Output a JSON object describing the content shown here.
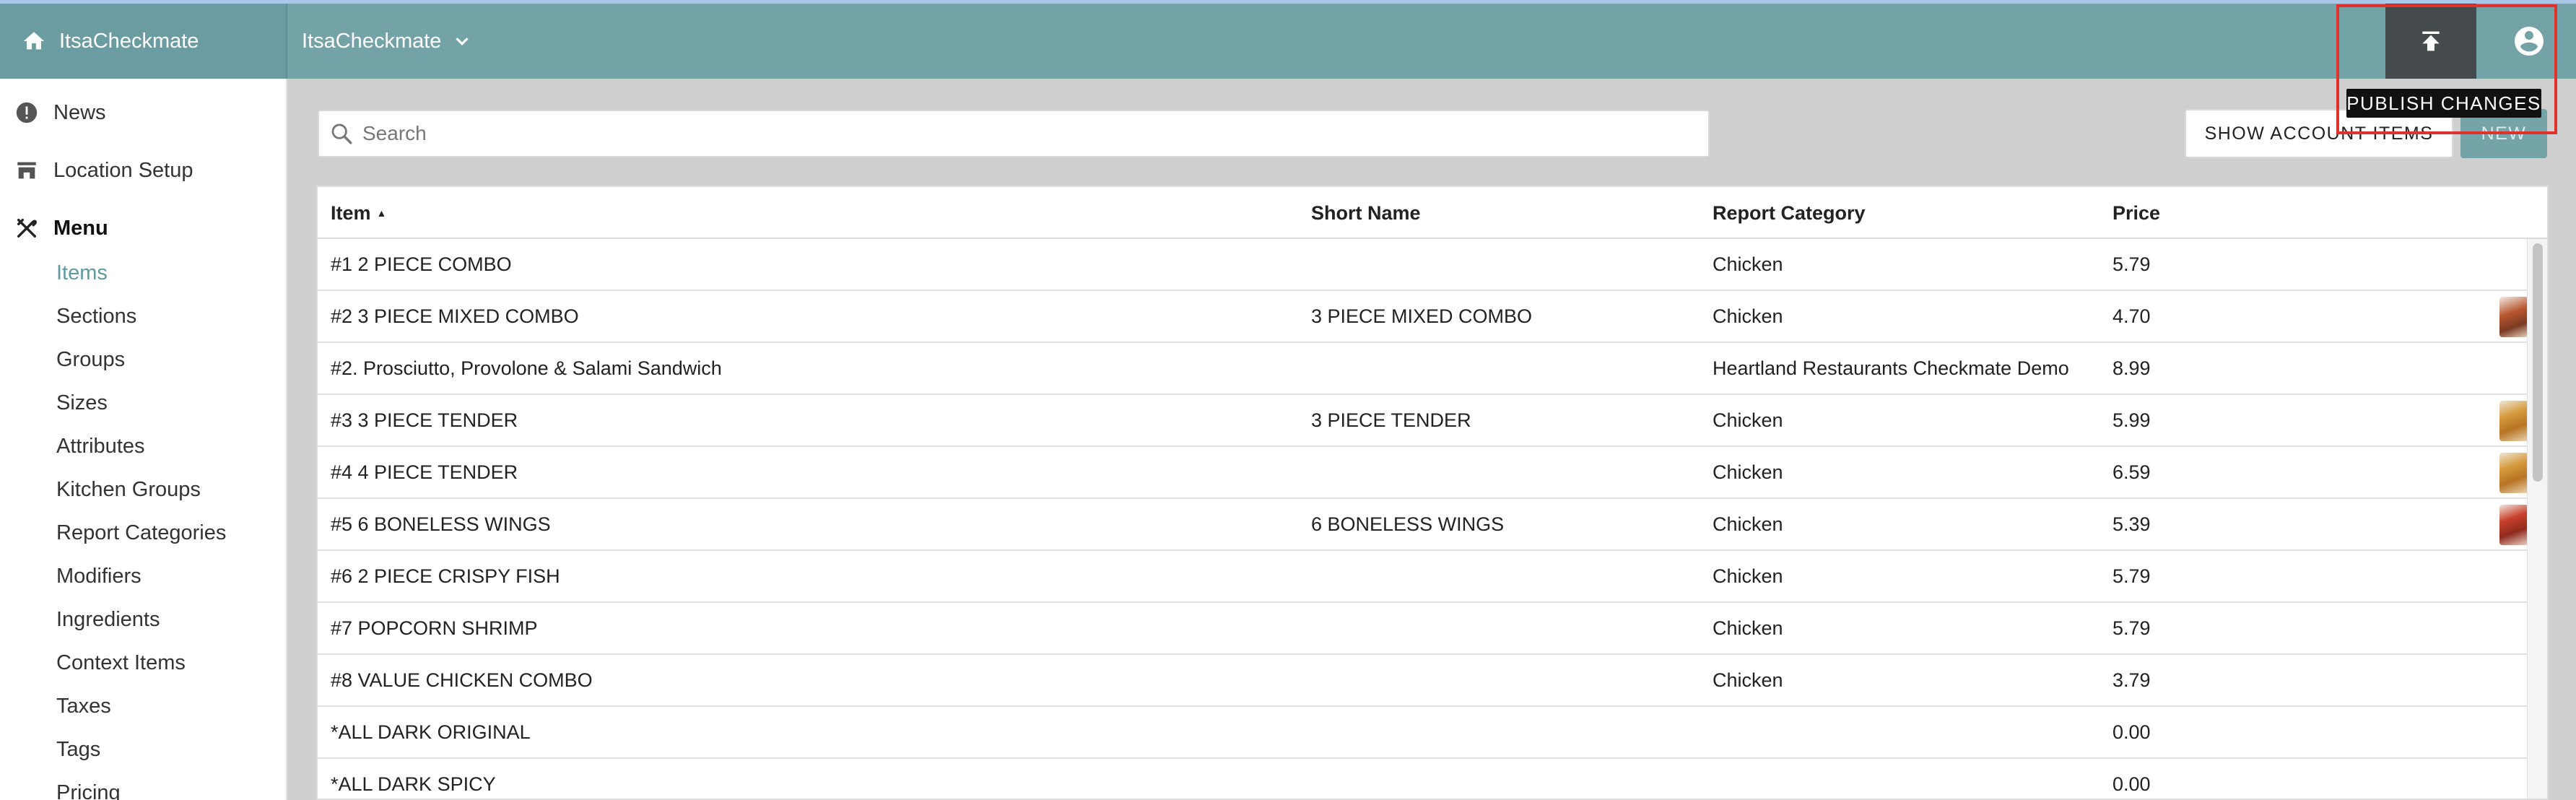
{
  "header": {
    "brand": "ItsaCheckmate",
    "location": "ItsaCheckmate",
    "publish_tooltip": "PUBLISH CHANGES"
  },
  "icons": {
    "home": "home-icon",
    "chevron": "chevron-down-icon",
    "publish": "publish-upload-icon",
    "account": "account-circle-icon",
    "news": "alert-circle-icon",
    "location": "store-icon",
    "menu": "fork-knife-icon",
    "search": "search-icon"
  },
  "sidebar": {
    "top": [
      {
        "label": "News"
      },
      {
        "label": "Location Setup"
      },
      {
        "label": "Menu"
      }
    ],
    "menu_items": [
      {
        "label": "Items",
        "active": true
      },
      {
        "label": "Sections"
      },
      {
        "label": "Groups"
      },
      {
        "label": "Sizes"
      },
      {
        "label": "Attributes"
      },
      {
        "label": "Kitchen Groups"
      },
      {
        "label": "Report Categories"
      },
      {
        "label": "Modifiers"
      },
      {
        "label": "Ingredients"
      },
      {
        "label": "Context Items"
      },
      {
        "label": "Taxes"
      },
      {
        "label": "Tags"
      },
      {
        "label": "Pricing"
      }
    ]
  },
  "toolbar": {
    "search_placeholder": "Search",
    "show_account_items": "SHOW ACCOUNT ITEMS",
    "new": "NEW"
  },
  "table": {
    "columns": [
      "Item",
      "Short Name",
      "Report Category",
      "Price"
    ],
    "sort_indicator": "▲",
    "rows": [
      {
        "item": "#1 2 PIECE COMBO",
        "short": "",
        "category": "Chicken",
        "price": "5.79"
      },
      {
        "item": "#2 3 PIECE MIXED COMBO",
        "short": "3 PIECE MIXED COMBO",
        "category": "Chicken",
        "price": "4.70"
      },
      {
        "item": "#2. Prosciutto, Provolone & Salami Sandwich",
        "short": "",
        "category": "Heartland Restaurants Checkmate Demo",
        "price": "8.99"
      },
      {
        "item": "#3 3 PIECE TENDER",
        "short": "3 PIECE TENDER",
        "category": "Chicken",
        "price": "5.99"
      },
      {
        "item": "#4 4 PIECE TENDER",
        "short": "",
        "category": "Chicken",
        "price": "6.59"
      },
      {
        "item": "#5 6 BONELESS WINGS",
        "short": "6 BONELESS WINGS",
        "category": "Chicken",
        "price": "5.39"
      },
      {
        "item": "#6 2 PIECE CRISPY FISH",
        "short": "",
        "category": "Chicken",
        "price": "5.79"
      },
      {
        "item": "#7 POPCORN SHRIMP",
        "short": "",
        "category": "Chicken",
        "price": "5.79"
      },
      {
        "item": "#8 VALUE CHICKEN COMBO",
        "short": "",
        "category": "Chicken",
        "price": "3.79"
      },
      {
        "item": "*ALL DARK ORIGINAL",
        "short": "",
        "category": "",
        "price": "0.00"
      },
      {
        "item": "*ALL DARK SPICY",
        "short": "",
        "category": "",
        "price": "0.00"
      }
    ]
  }
}
